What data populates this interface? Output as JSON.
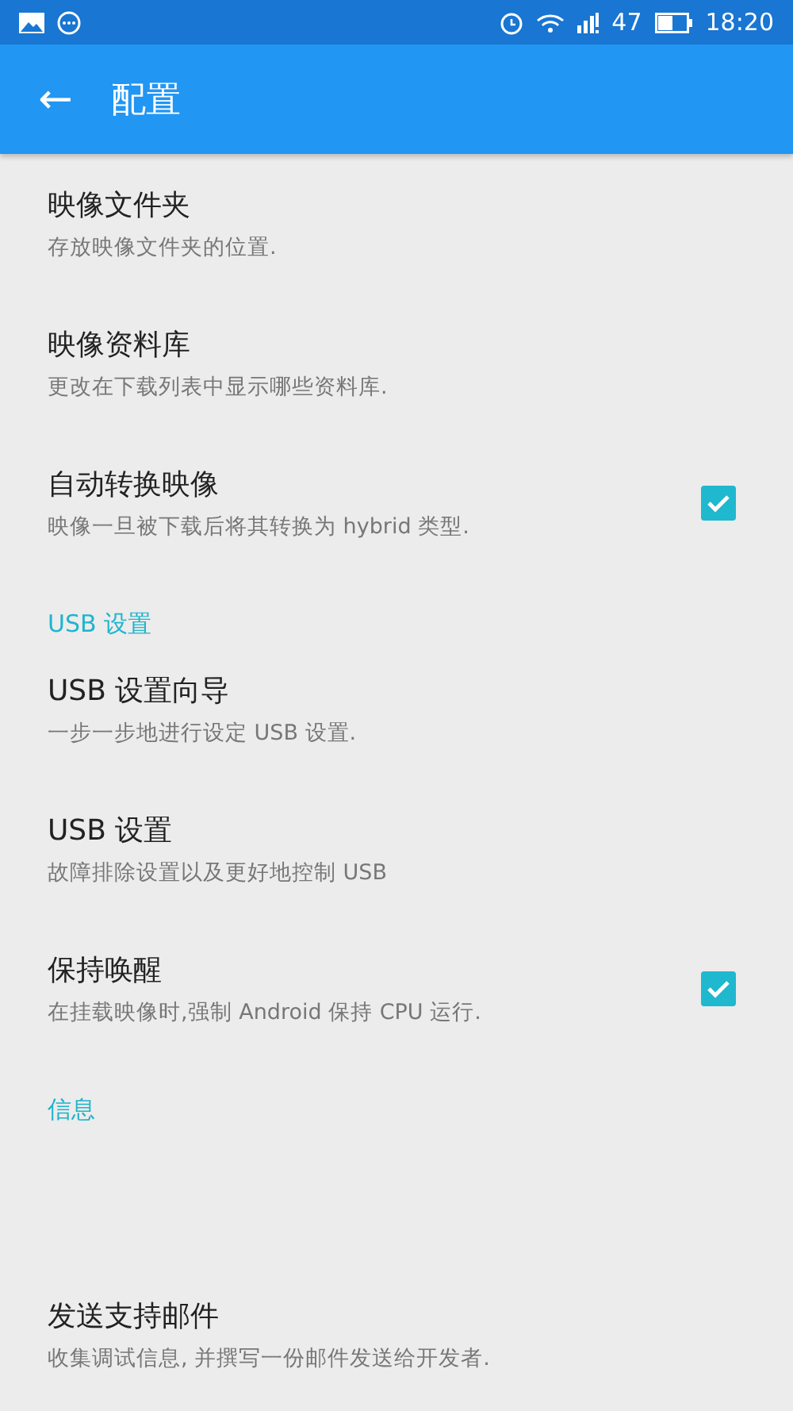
{
  "status_bar": {
    "battery_text": "47",
    "time": "18:20"
  },
  "toolbar": {
    "back": "←",
    "title": "配置"
  },
  "sections": [
    {
      "items": [
        {
          "kind": "plain",
          "title": "映像文件夹",
          "summary": "存放映像文件夹的位置."
        },
        {
          "kind": "plain",
          "title": "映像资料库",
          "summary": "更改在下载列表中显示哪些资料库."
        },
        {
          "kind": "checkbox",
          "title": "自动转换映像",
          "summary": "映像一旦被下载后将其转换为 hybrid 类型.",
          "checked": true
        }
      ]
    },
    {
      "header": "USB 设置",
      "items": [
        {
          "kind": "plain",
          "title": "USB 设置向导",
          "summary": "一步一步地进行设定 USB 设置."
        },
        {
          "kind": "plain",
          "title": "USB 设置",
          "summary": "故障排除设置以及更好地控制 USB"
        },
        {
          "kind": "checkbox",
          "title": "保持唤醒",
          "summary": "在挂载映像时,强制 Android 保持 CPU 运行.",
          "checked": true
        }
      ]
    },
    {
      "header": "信息",
      "items": [
        {
          "kind": "blank"
        },
        {
          "kind": "plain",
          "title": "发送支持邮件",
          "summary": "收集调试信息, 并撰写一份邮件发送给开发者."
        }
      ]
    }
  ]
}
